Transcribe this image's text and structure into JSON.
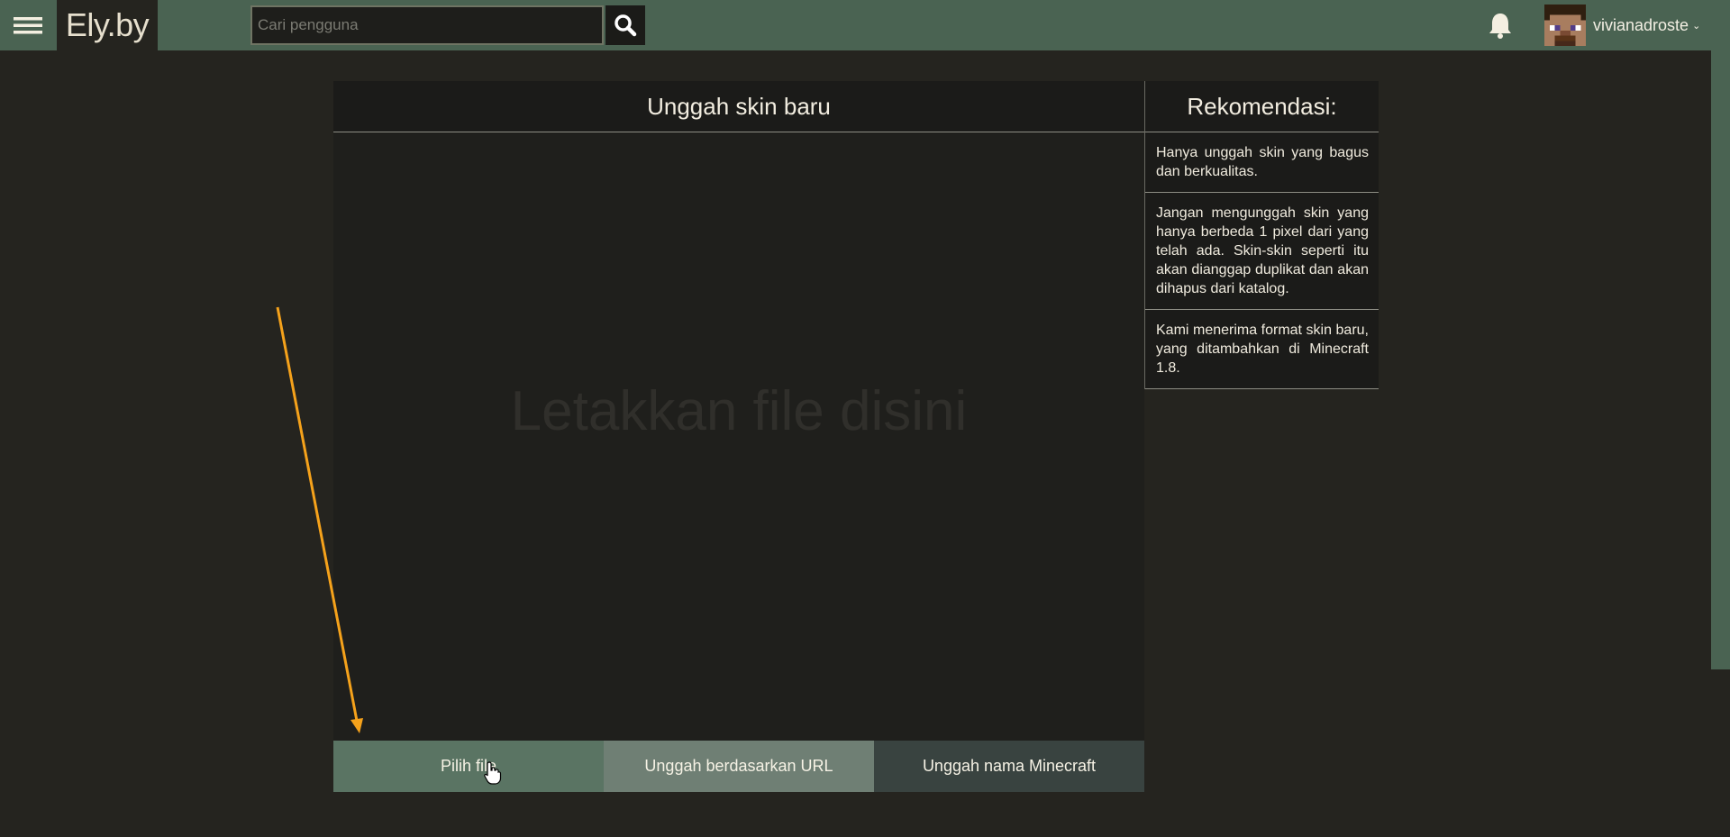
{
  "header": {
    "logo": "Ely.by",
    "search_placeholder": "Cari pengguna",
    "username": "vivianadroste",
    "caret": "⌄"
  },
  "upload": {
    "title": "Unggah skin baru",
    "dropzone_text": "Letakkan file disini",
    "buttons": {
      "choose_file": "Pilih file",
      "by_url": "Unggah berdasarkan URL",
      "by_minecraft_name": "Unggah nama Minecraft"
    }
  },
  "recommendations": {
    "title": "Rekomendasi:",
    "items": [
      "Hanya unggah skin yang bagus dan berkualitas.",
      "Jangan mengunggah skin yang hanya berbeda 1 pixel dari yang telah ada. Skin-skin seperti itu akan dianggap duplikat dan akan dihapus dari katalog.",
      "Kami menerima format skin baru, yang ditambahkan di Minecraft 1.8."
    ]
  },
  "colors": {
    "accent": "#4a6352",
    "background": "#25241f",
    "annotation_arrow": "#f5a21b"
  },
  "icons": [
    "hamburger-menu-icon",
    "search-icon",
    "bell-icon",
    "avatar",
    "hand-pointer-cursor-icon",
    "annotation-arrow"
  ]
}
